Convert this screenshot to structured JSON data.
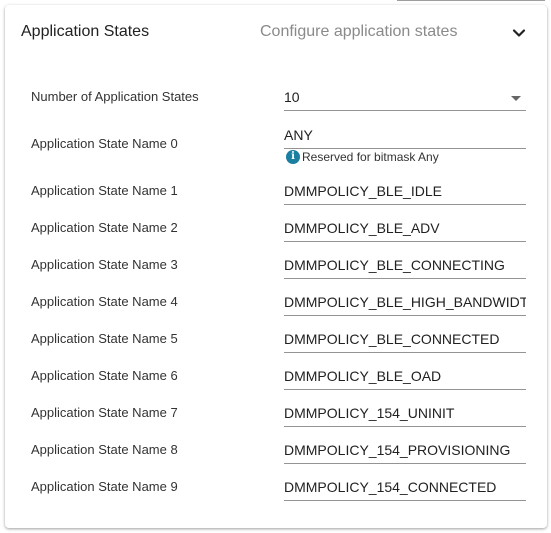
{
  "panel": {
    "title": "Application States",
    "subtitle": "Configure application states",
    "expand_icon": "chevron-down-icon"
  },
  "num_states": {
    "label": "Number of Application States",
    "value": "10"
  },
  "states": [
    {
      "label": "Application State Name 0",
      "value": "ANY",
      "helper": "Reserved for bitmask Any",
      "helper_icon": "info-icon"
    },
    {
      "label": "Application State Name 1",
      "value": "DMMPOLICY_BLE_IDLE"
    },
    {
      "label": "Application State Name 2",
      "value": "DMMPOLICY_BLE_ADV"
    },
    {
      "label": "Application State Name 3",
      "value": "DMMPOLICY_BLE_CONNECTING"
    },
    {
      "label": "Application State Name 4",
      "value": "DMMPOLICY_BLE_HIGH_BANDWIDTH"
    },
    {
      "label": "Application State Name 5",
      "value": "DMMPOLICY_BLE_CONNECTED"
    },
    {
      "label": "Application State Name 6",
      "value": "DMMPOLICY_BLE_OAD"
    },
    {
      "label": "Application State Name 7",
      "value": "DMMPOLICY_154_UNINIT"
    },
    {
      "label": "Application State Name 8",
      "value": "DMMPOLICY_154_PROVISIONING"
    },
    {
      "label": "Application State Name 9",
      "value": "DMMPOLICY_154_CONNECTED"
    }
  ],
  "colors": {
    "info_icon": "#1a7fa0",
    "subtitle": "#8a8a8a"
  }
}
